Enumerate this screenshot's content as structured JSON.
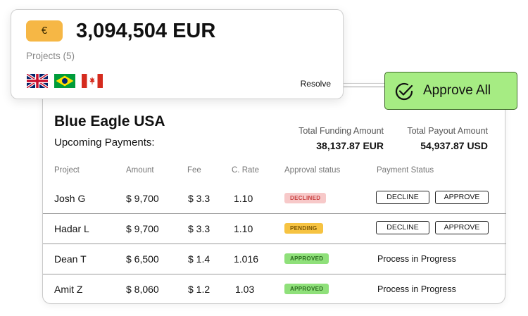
{
  "summary": {
    "currency_symbol": "€",
    "amount": "3,094,504 EUR",
    "projects": "Projects (5)",
    "flags": [
      "uk-flag-icon",
      "brazil-flag-icon",
      "canada-flag-icon"
    ],
    "resolve_label": "Resolve"
  },
  "approve_all": {
    "label": "Approve All",
    "icon": "check-circle-icon"
  },
  "company": {
    "name": "Blue Eagle USA",
    "subtitle": "Upcoming Payments:"
  },
  "totals": {
    "funding_label": "Total Funding Amount",
    "funding_value": "38,137.87 EUR",
    "payout_label": "Total Payout Amount",
    "payout_value": "54,937.87 USD"
  },
  "table": {
    "headers": [
      "Project",
      "Amount",
      "Fee",
      "C. Rate",
      "Approval status",
      "Payment Status"
    ],
    "rows": [
      {
        "project": "Josh G",
        "amount": "$ 9,700",
        "fee": "$ 3.3",
        "rate": "1.10",
        "approval": "DECLINED",
        "decline": "DECLINE",
        "approve": "APPROVE"
      },
      {
        "project": "Hadar L",
        "amount": "$ 9,700",
        "fee": "$ 3.3",
        "rate": "1.10",
        "approval": "PENDING",
        "decline": "DECLINE",
        "approve": "APPROVE"
      },
      {
        "project": "Dean T",
        "amount": "$ 6,500",
        "fee": "$ 1.4",
        "rate": "1.016",
        "approval": "APPROVED",
        "payment": "Process in Progress"
      },
      {
        "project": "Amit Z",
        "amount": "$ 8,060",
        "fee": "$ 1.2",
        "rate": "1.03",
        "approval": "APPROVED",
        "payment": "Process in Progress"
      }
    ]
  },
  "colors": {
    "euro_badge": "#f6b745",
    "approve_all_bg": "#a6ec83",
    "declined": "#f7c9c9",
    "pending": "#f6c342",
    "approved": "#8fe07a"
  }
}
